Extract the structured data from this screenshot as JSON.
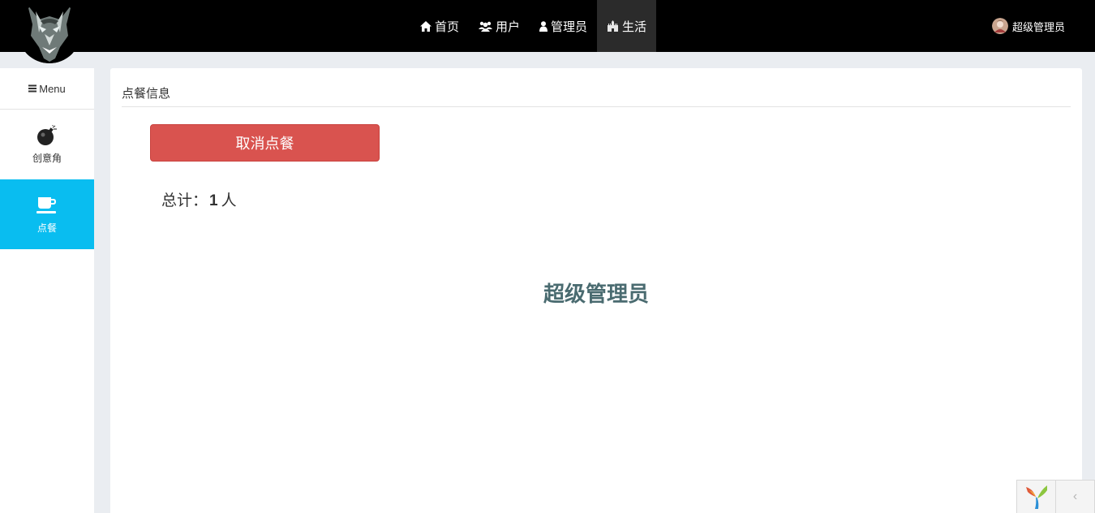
{
  "nav": {
    "items": [
      {
        "label": "首页",
        "icon": "home-icon"
      },
      {
        "label": "用户",
        "icon": "users-icon"
      },
      {
        "label": "管理员",
        "icon": "user-icon"
      },
      {
        "label": "生活",
        "icon": "castle-icon",
        "active": true
      }
    ],
    "user_name": "超级管理员"
  },
  "sidebar": {
    "menu_label": "Menu",
    "items": [
      {
        "label": "创意角",
        "icon": "bomb-icon",
        "active": false
      },
      {
        "label": "点餐",
        "icon": "coffee-icon",
        "active": true
      }
    ]
  },
  "main": {
    "title": "点餐信息",
    "cancel_label": "取消点餐",
    "total_prefix": "总计：",
    "total_count": "1",
    "total_unit": "人",
    "diners": [
      "超级管理员"
    ]
  },
  "debug_toolbar": {
    "logo": "yii-logo-icon",
    "toggle": "chevron-left-icon"
  },
  "colors": {
    "navbar_bg": "#000000",
    "nav_active_bg": "#2b2b2b",
    "sidebar_active_bg": "#09bdf0",
    "danger_button": "#d9534f",
    "diner_text": "#4a6b70",
    "page_bg": "#eaedf1"
  }
}
